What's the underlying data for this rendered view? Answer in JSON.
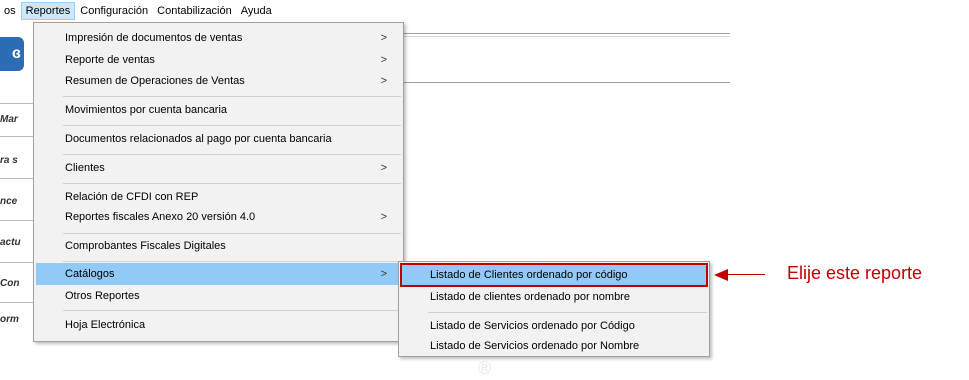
{
  "menubar": {
    "items": [
      "os",
      "Reportes",
      "Configuración",
      "Contabilización",
      "Ayuda"
    ]
  },
  "side_labels": [
    "Mar",
    "ra s",
    "nce",
    "actu",
    "Con",
    "orm"
  ],
  "app_icon_glyph": "ɞ",
  "reportes_menu": {
    "items": [
      {
        "label": "Impresión de documentos de ventas",
        "submenu": true
      },
      {
        "label": "Reporte de ventas",
        "submenu": true
      },
      {
        "label": "Resumen de Operaciones de Ventas",
        "submenu": true
      },
      {
        "label": "Movimientos por cuenta bancaria",
        "submenu": false
      },
      {
        "label": "Documentos relacionados al pago por cuenta bancaria",
        "submenu": false
      },
      {
        "label": "Clientes",
        "submenu": true
      },
      {
        "label": "Relación de CFDI con REP",
        "submenu": false
      },
      {
        "label": "Reportes fiscales Anexo 20 versión 4.0",
        "submenu": true
      },
      {
        "label": "Comprobantes Fiscales Digitales",
        "submenu": false
      },
      {
        "label": "Catálogos",
        "submenu": true,
        "highlighted": true
      },
      {
        "label": "Otros Reportes",
        "submenu": false
      },
      {
        "label": "Hoja Electrónica",
        "submenu": false
      }
    ],
    "arrow_glyph": ">"
  },
  "catalogos_submenu": {
    "items": [
      {
        "label": "Listado de Clientes ordenado por código",
        "highlighted": true
      },
      {
        "label": "Listado de clientes ordenado por nombre"
      },
      {
        "label": "Listado de Servicios ordenado por Código"
      },
      {
        "label": "Listado de Servicios ordenado por Nombre"
      }
    ]
  },
  "annotation": {
    "text": "Elije este reporte",
    "color": "#c00000"
  },
  "watermark": "®",
  "colors": {
    "menu_bg": "#f2f2f2",
    "highlight": "#91c9f7",
    "active_menubar": "#cce8ff"
  }
}
